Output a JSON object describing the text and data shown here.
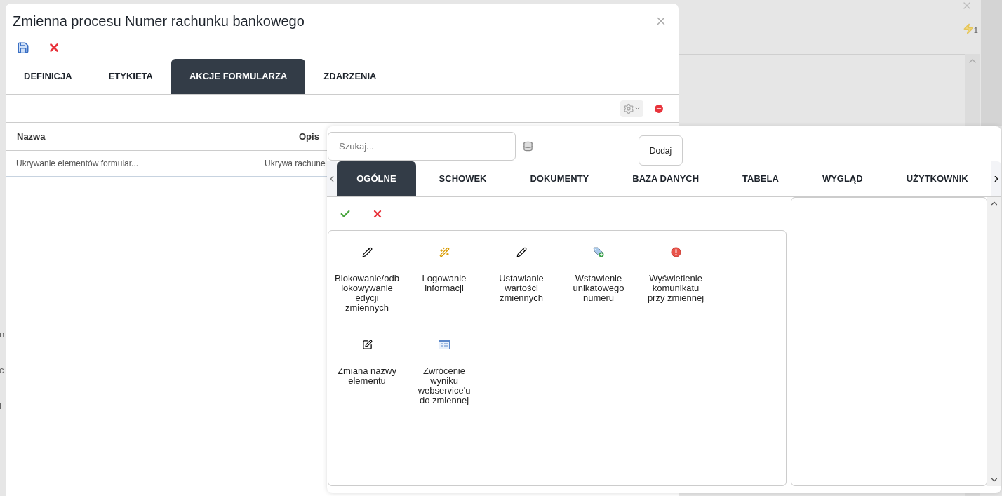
{
  "background": {
    "badge_count": "1",
    "fragments": [
      "n",
      "c",
      "l"
    ]
  },
  "dialog": {
    "title": "Zmienna procesu Numer rachunku bankowego",
    "tabs": [
      {
        "label": "DEFINICJA",
        "selected": false
      },
      {
        "label": "ETYKIETA",
        "selected": false
      },
      {
        "label": "AKCJE FORMULARZA",
        "selected": true
      },
      {
        "label": "ZDARZENIA",
        "selected": false
      }
    ],
    "table": {
      "columns": [
        "Nazwa",
        "Opis"
      ],
      "rows": [
        [
          "Ukrywanie elementów formular...",
          "Ukrywa rachune"
        ]
      ]
    }
  },
  "popup": {
    "search": {
      "placeholder": "Szukaj..."
    },
    "add_button": "Dodaj",
    "tabs": [
      {
        "label": "OGÓLNE",
        "selected": true
      },
      {
        "label": "SCHOWEK",
        "selected": false
      },
      {
        "label": "DOKUMENTY",
        "selected": false
      },
      {
        "label": "BAZA DANYCH",
        "selected": false
      },
      {
        "label": "TABELA",
        "selected": false
      },
      {
        "label": "WYGLĄD",
        "selected": false
      },
      {
        "label": "UŻYTKOWNIK",
        "selected": false
      }
    ],
    "actions": [
      {
        "kind": "pencil",
        "label": "Blokowanie/odb lokowywanie edycji zmiennych"
      },
      {
        "kind": "wand",
        "label": "Logowanie informacji"
      },
      {
        "kind": "pencil",
        "label": "Ustawianie wartości zmiennych"
      },
      {
        "kind": "tag",
        "label": "Wstawienie unikatowego numeru"
      },
      {
        "kind": "alert",
        "label": "Wyświetlenie komunikatu przy zmiennej"
      },
      {
        "kind": "rename",
        "label": "Zmiana nazwy elementu"
      },
      {
        "kind": "form",
        "label": "Zwrócenie wyniku webservice'u do zmiennej"
      }
    ]
  }
}
